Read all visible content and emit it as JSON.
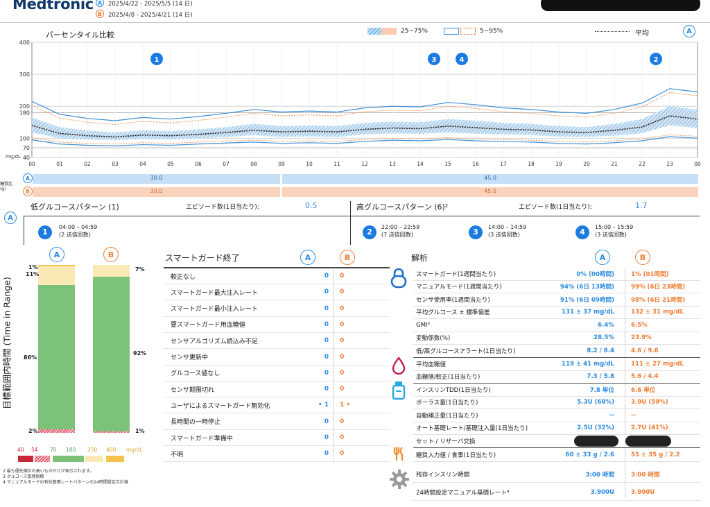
{
  "header": {
    "brand": "Medtronic",
    "period_a_mark": "A",
    "period_a": "2025/4/22 - 2025/5/5 (14 日)",
    "period_b_mark": "B",
    "period_b": "2025/4/8 - 2025/4/21 (14 日)"
  },
  "percentile": {
    "title": "パーセンタイル比較",
    "legend_25_75": "25~75%",
    "legend_5_95": "5~95%",
    "legend_mean": "平均",
    "period_mark": "A",
    "y_unit": "mg/dL",
    "markers": [
      {
        "label": "1",
        "hour": 4.5
      },
      {
        "label": "3",
        "hour": 14.5
      },
      {
        "label": "4",
        "hour": 15.5
      },
      {
        "label": "2",
        "hour": 22.5
      }
    ]
  },
  "chart_data": {
    "type": "line",
    "title": "パーセンタイル比較",
    "ylabel": "mg/dL",
    "ylim": [
      40,
      400
    ],
    "yticks": [
      40,
      70,
      100,
      180,
      200,
      300,
      400
    ],
    "xticks": [
      "00",
      "01",
      "02",
      "03",
      "04",
      "05",
      "06",
      "07",
      "08",
      "09",
      "10",
      "11",
      "12",
      "13",
      "14",
      "15",
      "16",
      "17",
      "18",
      "19",
      "20",
      "21",
      "22",
      "23",
      "00"
    ],
    "x": [
      0,
      1,
      2,
      3,
      4,
      5,
      6,
      7,
      8,
      9,
      10,
      11,
      12,
      13,
      14,
      15,
      16,
      17,
      18,
      19,
      20,
      21,
      22,
      23,
      24
    ],
    "series": [
      {
        "name": "平均",
        "values": [
          140,
          115,
          108,
          104,
          110,
          108,
          112,
          118,
          125,
          120,
          122,
          120,
          128,
          132,
          130,
          138,
          133,
          128,
          126,
          120,
          118,
          125,
          135,
          170,
          160
        ]
      },
      {
        "name": "25~75%",
        "low": [
          118,
          100,
          96,
          94,
          98,
          96,
          100,
          104,
          110,
          104,
          106,
          104,
          112,
          115,
          114,
          118,
          114,
          112,
          110,
          105,
          104,
          108,
          116,
          140,
          132
        ],
        "high": [
          165,
          135,
          124,
          118,
          125,
          122,
          128,
          135,
          145,
          138,
          140,
          138,
          148,
          152,
          150,
          160,
          155,
          148,
          145,
          138,
          135,
          145,
          160,
          200,
          190
        ]
      },
      {
        "name": "5~95%",
        "low": [
          95,
          82,
          78,
          76,
          80,
          78,
          82,
          85,
          88,
          84,
          86,
          84,
          90,
          94,
          92,
          96,
          92,
          90,
          88,
          84,
          82,
          86,
          92,
          105,
          100
        ],
        "high": [
          215,
          175,
          162,
          155,
          165,
          160,
          168,
          178,
          190,
          182,
          185,
          182,
          195,
          200,
          198,
          212,
          205,
          195,
          190,
          182,
          178,
          190,
          210,
          255,
          245
        ]
      }
    ]
  },
  "carbs_bar": {
    "label": "糖質比(g)",
    "a_mark": "A",
    "b_mark": "B",
    "a_values": [
      "30.0",
      "45.0"
    ],
    "b_values": [
      "30.0",
      "45.0"
    ]
  },
  "patterns": {
    "mark": "A",
    "low_title": "低グルコースパターン (1)",
    "low_episodes_label": "エピソード数(1日当たり):",
    "low_episodes_value": "0.5",
    "high_title": "高グルコースパターン (6)²",
    "high_episodes_label": "エピソード数(1日当たり):",
    "high_episodes_value": "1.7",
    "low_items": [
      {
        "num": "1",
        "time": "04:00 – 04:59",
        "count": "(2 送信回数)"
      }
    ],
    "high_items": [
      {
        "num": "2",
        "time": "22:00 – 22:59",
        "count": "(7 送信回数)"
      },
      {
        "num": "3",
        "time": "14:00 – 14:59",
        "count": "(3 送信回数)"
      },
      {
        "num": "4",
        "time": "15:00 – 15:59",
        "count": "(3 送信回数)"
      }
    ]
  },
  "tir": {
    "vertical_title": "目標範囲内時間 (Time in Range)",
    "a_mark": "A",
    "b_mark": "B",
    "a_labels": {
      "very_high": "1%",
      "high": "11%",
      "in_range": "86%",
      "low": "2%"
    },
    "b_labels": {
      "high": "7%",
      "in_range": "92%",
      "low": "1%"
    },
    "a_pct": {
      "very_high": 1,
      "high": 11,
      "in_range": 86,
      "low": 2
    },
    "b_pct": {
      "very_high": 0,
      "high": 7,
      "in_range": 92,
      "low": 1
    },
    "scale_ticks": [
      "40",
      "54",
      "70",
      "180",
      "250",
      "400"
    ],
    "scale_unit": "mg/dL",
    "colors": {
      "very_low": "#c8283a",
      "low": "#e36070",
      "in_range": "#7cc278",
      "high": "#fbe9b5",
      "very_high": "#f4c24e"
    }
  },
  "footnotes": [
    "2 最も優先順位の高いものだけが表示されます。",
    "3 グルコース管理指標",
    "4 マニュアルモードの有効基礎レートパターンの24時間設定合計値"
  ],
  "smartguard": {
    "title": "スマートガード終了",
    "a_mark": "A",
    "b_mark": "B",
    "rows": [
      {
        "label": "較正なし",
        "a": "0",
        "b": "0"
      },
      {
        "label": "スマートガード最大注入レート",
        "a": "0",
        "b": "0"
      },
      {
        "label": "スマートガード最小注入レート",
        "a": "0",
        "b": "0"
      },
      {
        "label": "要スマートガード用血糖値",
        "a": "0",
        "b": "0"
      },
      {
        "label": "センサアルゴリズム読込み不足",
        "a": "0",
        "b": "0"
      },
      {
        "label": "センサ更新中",
        "a": "0",
        "b": "0"
      },
      {
        "label": "グルコース値なし",
        "a": "0",
        "b": "0"
      },
      {
        "label": "センサ期限切れ",
        "a": "0",
        "b": "0"
      },
      {
        "label": "ユーザによるスマートガード無効化",
        "a": "• 1",
        "b": "1 •"
      },
      {
        "label": "長時間の一時停止",
        "a": "0",
        "b": "0"
      },
      {
        "label": "スマートガード準備中",
        "a": "0",
        "b": "0"
      },
      {
        "label": "不明",
        "a": "0",
        "b": "0"
      }
    ]
  },
  "analysis": {
    "title": "解析",
    "a_mark": "A",
    "b_mark": "B",
    "rows": [
      {
        "label": "スマートガード(1週間当たり)",
        "a": "0% (00時間)",
        "b": "1% (01時間)"
      },
      {
        "label": "マニュアルモード(1週間当たり)",
        "a": "94% (6日 13時間)",
        "b": "99% (6日 23時間)"
      },
      {
        "label": "センサ使用率(1週間当たり)",
        "a": "91% (6日 09時間)",
        "b": "98% (6日 21時間)"
      },
      {
        "label": "平均グルコース ± 標準偏差",
        "a": "131 ± 37 mg/dL",
        "b": "132 ± 31 mg/dL"
      },
      {
        "label": "GMI³",
        "a": "6.4%",
        "b": "6.5%"
      },
      {
        "label": "変動係数(%)",
        "a": "28.5%",
        "b": "23.9%"
      },
      {
        "label": "低/高グルコースアラート(1日当たり)",
        "a": "8.2 / 8.4",
        "b": "4.6 / 9.6"
      },
      {
        "label": "平均血糖値",
        "a": "119 ± 41 mg/dL",
        "b": "111 ± 27 mg/dL"
      },
      {
        "label": "血糖値/較正(1日当たり)",
        "a": "7.3 / 5.8",
        "b": "5.6 / 4.4"
      },
      {
        "label": "インスリンTDD(1日当たり)",
        "a": "7.8 単位",
        "b": "6.6 単位"
      },
      {
        "label": "ボーラス量(1日当たり)",
        "a": "5.3U (68%)",
        "b": "3.9U (59%)"
      },
      {
        "label": "自動補正量(1日当たり)",
        "a": "--",
        "b": "--"
      },
      {
        "label": "オート基礎レート/基礎注入量(1日当たり)",
        "a": "2.5U (32%)",
        "b": "2.7U (41%)"
      },
      {
        "label": "セット / リザーバ交換",
        "a": "",
        "b": ""
      },
      {
        "label": "糖質入力値 / 食事(1日当たり)",
        "a": "60 ± 33 g / 2.6",
        "b": "55 ± 35 g / 2.2"
      },
      {
        "label": "残存インスリン時間",
        "a": "3:00 時間",
        "b": "3:00 時間"
      },
      {
        "label": "24時間設定マニュアル基礎レート⁴",
        "a": "3.900U",
        "b": "3.900U"
      }
    ]
  }
}
